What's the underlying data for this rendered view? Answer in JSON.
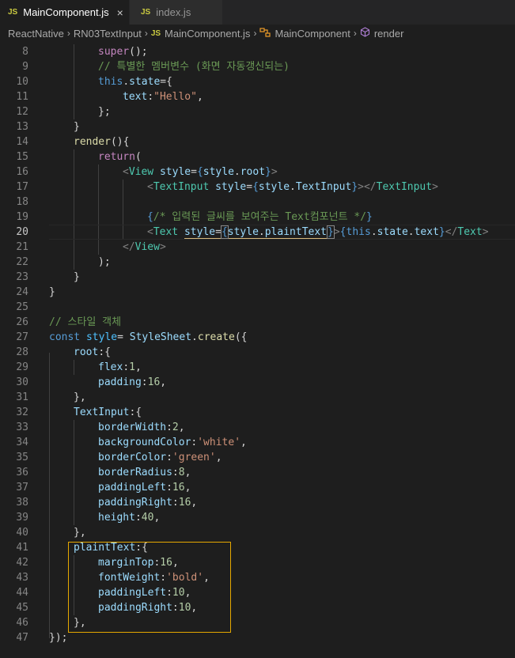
{
  "tabs": [
    {
      "icon": "JS",
      "label": "MainComponent.js",
      "close": "×"
    },
    {
      "icon": "JS",
      "label": "index.js"
    }
  ],
  "breadcrumb": {
    "items": [
      "ReactNative",
      "RN03TextInput",
      "MainComponent.js",
      "MainComponent",
      "render"
    ],
    "file_icon": "JS"
  },
  "lines": [
    {
      "n": "8"
    },
    {
      "n": "9"
    },
    {
      "n": "10"
    },
    {
      "n": "11"
    },
    {
      "n": "12"
    },
    {
      "n": "13"
    },
    {
      "n": "14"
    },
    {
      "n": "15"
    },
    {
      "n": "16"
    },
    {
      "n": "17"
    },
    {
      "n": "18"
    },
    {
      "n": "19"
    },
    {
      "n": "20"
    },
    {
      "n": "21"
    },
    {
      "n": "22"
    },
    {
      "n": "23"
    },
    {
      "n": "24"
    },
    {
      "n": "25"
    },
    {
      "n": "26"
    },
    {
      "n": "27"
    },
    {
      "n": "28"
    },
    {
      "n": "29"
    },
    {
      "n": "30"
    },
    {
      "n": "31"
    },
    {
      "n": "32"
    },
    {
      "n": "33"
    },
    {
      "n": "34"
    },
    {
      "n": "35"
    },
    {
      "n": "36"
    },
    {
      "n": "37"
    },
    {
      "n": "38"
    },
    {
      "n": "39"
    },
    {
      "n": "40"
    },
    {
      "n": "41"
    },
    {
      "n": "42"
    },
    {
      "n": "43"
    },
    {
      "n": "44"
    },
    {
      "n": "45"
    },
    {
      "n": "46"
    },
    {
      "n": "47"
    }
  ],
  "code": {
    "l8": [
      "super",
      "();"
    ],
    "l9": "// 특별한 멤버변수 (화면 자동갱신되는)",
    "l10": [
      "this",
      ".",
      "state",
      "={"
    ],
    "l11": [
      "text",
      ":",
      "\"Hello\"",
      ","
    ],
    "l12": "};",
    "l13": "}",
    "l14": [
      "render",
      "(){"
    ],
    "l15": [
      "return",
      "("
    ],
    "l16": [
      "<",
      "View",
      " ",
      "style",
      "=",
      "{",
      "style",
      ".",
      "root",
      "}",
      ">"
    ],
    "l17": [
      "<",
      "TextInput",
      " ",
      "style",
      "=",
      "{",
      "style",
      ".",
      "TextInput",
      "}",
      "></",
      "TextInput",
      ">"
    ],
    "l19": [
      "{",
      "/* 입력된 글씨를 보여주는 Text컴포넌트 */",
      "}"
    ],
    "l20": [
      "<",
      "Text",
      " ",
      "style",
      "=",
      "{",
      "style",
      ".",
      "plaintText",
      "}",
      ">",
      "{",
      "this",
      ".",
      "state",
      ".",
      "text",
      "}",
      "</",
      "Text",
      ">"
    ],
    "l21": [
      "</",
      "View",
      ">"
    ],
    "l22": ");",
    "l23": "}",
    "l24": "}",
    "l26": "// 스타일 객체",
    "l27": [
      "const",
      " ",
      "style",
      "= ",
      "StyleSheet",
      ".",
      "create",
      "({"
    ],
    "l28": [
      "root",
      ":{"
    ],
    "l29": [
      "flex",
      ":",
      "1",
      ","
    ],
    "l30": [
      "padding",
      ":",
      "16",
      ","
    ],
    "l31": "},",
    "l32": [
      "TextInput",
      ":{"
    ],
    "l33": [
      "borderWidth",
      ":",
      "2",
      ","
    ],
    "l34": [
      "backgroundColor",
      ":",
      "'white'",
      ","
    ],
    "l35": [
      "borderColor",
      ":",
      "'green'",
      ","
    ],
    "l36": [
      "borderRadius",
      ":",
      "8",
      ","
    ],
    "l37": [
      "paddingLeft",
      ":",
      "16",
      ","
    ],
    "l38": [
      "paddingRight",
      ":",
      "16",
      ","
    ],
    "l39": [
      "height",
      ":",
      "40",
      ","
    ],
    "l40": "},",
    "l41": [
      "plaintText",
      ":{"
    ],
    "l42": [
      "marginTop",
      ":",
      "16",
      ","
    ],
    "l43": [
      "fontWeight",
      ":",
      "'bold'",
      ","
    ],
    "l44": [
      "paddingLeft",
      ":",
      "10",
      ","
    ],
    "l45": [
      "paddingRight",
      ":",
      "10",
      ","
    ],
    "l46": "},",
    "l47": "});"
  },
  "colors": {
    "keyword": "#569cd6",
    "control": "#c586c0",
    "function": "#dcdcaa",
    "variable": "#9cdcfe",
    "number": "#b5cea8",
    "string": "#ce9178",
    "comment": "#6a9955",
    "type": "#4ec9b0",
    "highlight_box": "#e5a800"
  }
}
